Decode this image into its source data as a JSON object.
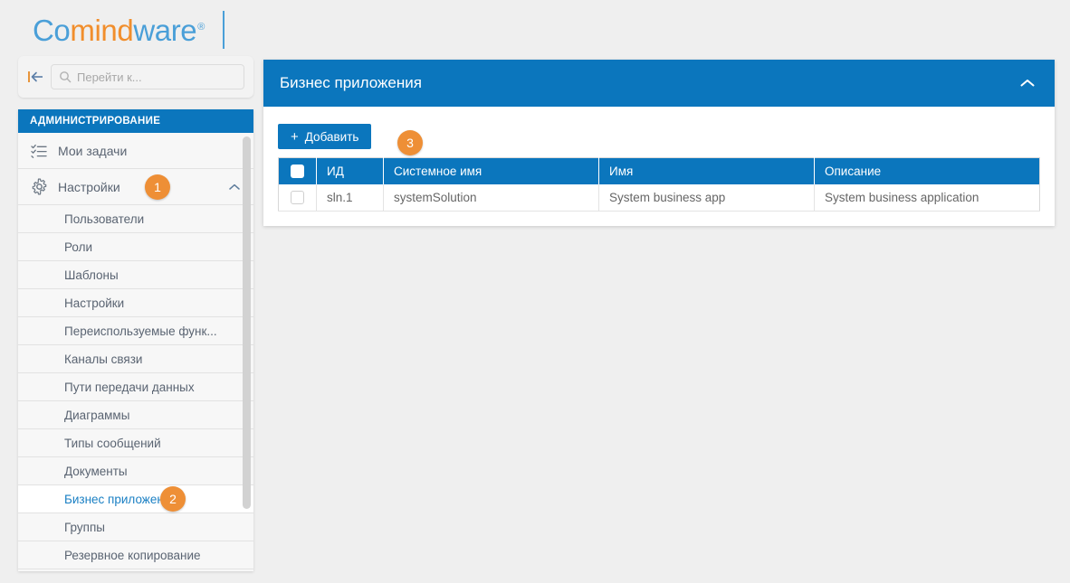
{
  "brand": {
    "name_part1": "Co",
    "name_part2": "mind",
    "name_part3": "ware",
    "registered_mark": "®",
    "blue": "#4a9fd8",
    "orange": "#f18e2c"
  },
  "theme": {
    "accent_blue": "#0b76bd",
    "badge_orange": "#ee8f36",
    "page_background": "#efefef"
  },
  "search": {
    "placeholder": "Перейти к...",
    "value": "",
    "collapse_icon": "collapse-left-icon",
    "icon": "search-icon"
  },
  "sidebar": {
    "header": "АДМИНИСТРИРОВАНИЕ",
    "items": [
      {
        "label": "Мои задачи",
        "icon": "task-list-icon"
      },
      {
        "label": "Настройки",
        "icon": "gear-icon",
        "chevron": "chevron-up-icon",
        "badge": "1"
      }
    ],
    "subitems": [
      {
        "label": "Пользователи"
      },
      {
        "label": "Роли"
      },
      {
        "label": "Шаблоны"
      },
      {
        "label": "Настройки"
      },
      {
        "label": "Переиспользуемые функ..."
      },
      {
        "label": "Каналы связи"
      },
      {
        "label": "Пути передачи данных"
      },
      {
        "label": "Диаграммы"
      },
      {
        "label": "Типы сообщений"
      },
      {
        "label": "Документы"
      },
      {
        "label": "Бизнес приложения",
        "selected": true,
        "badge": "2"
      },
      {
        "label": "Группы"
      },
      {
        "label": "Резервное копирование"
      }
    ]
  },
  "panel": {
    "title": "Бизнес приложения",
    "collapse_icon": "chevron-up-icon",
    "toolbar": {
      "add_label": "Добавить",
      "add_plus": "+",
      "badge": "3"
    },
    "table": {
      "columns": [
        "",
        "ИД",
        "Системное имя",
        "Имя",
        "Описание"
      ],
      "rows": [
        {
          "checked": false,
          "id": "sln.1",
          "system_name": "systemSolution",
          "name": "System business app",
          "description": "System business application"
        }
      ]
    }
  }
}
